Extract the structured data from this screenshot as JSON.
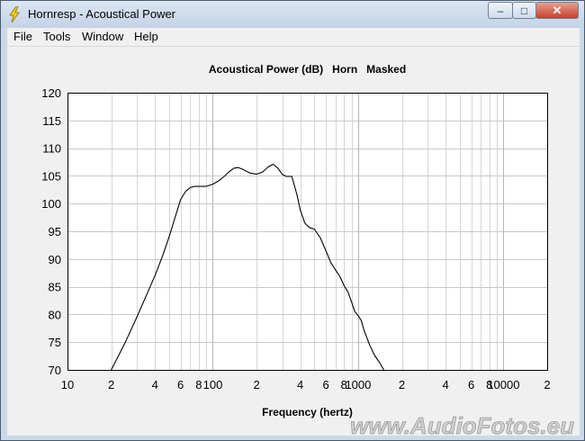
{
  "window": {
    "title": "Hornresp - Acoustical Power",
    "minimize_glyph": "–",
    "maximize_glyph": "□",
    "close_glyph": "✕",
    "app_icon": "lightning-bolt-icon"
  },
  "menu": {
    "items": [
      "File",
      "Tools",
      "Window",
      "Help"
    ]
  },
  "watermark": "www.AudioFotos.eu",
  "chart_data": {
    "type": "line",
    "title": "Acoustical Power (dB)   Horn   Masked",
    "xlabel": "Frequency (hertz)",
    "ylabel": "",
    "x_scale": "log",
    "xlim": [
      10,
      20000
    ],
    "ylim": [
      70,
      120
    ],
    "grid": true,
    "y_ticks": [
      70,
      75,
      80,
      85,
      90,
      95,
      100,
      105,
      110,
      115,
      120
    ],
    "x_ticks": [
      {
        "value": 10,
        "label": "10"
      },
      {
        "value": 20,
        "label": "2"
      },
      {
        "value": 40,
        "label": "4"
      },
      {
        "value": 60,
        "label": "6"
      },
      {
        "value": 80,
        "label": "8"
      },
      {
        "value": 100,
        "label": "100"
      },
      {
        "value": 200,
        "label": "2"
      },
      {
        "value": 400,
        "label": "4"
      },
      {
        "value": 600,
        "label": "6"
      },
      {
        "value": 800,
        "label": "8"
      },
      {
        "value": 1000,
        "label": "1000"
      },
      {
        "value": 2000,
        "label": "2"
      },
      {
        "value": 4000,
        "label": "4"
      },
      {
        "value": 6000,
        "label": "6"
      },
      {
        "value": 8000,
        "label": "8"
      },
      {
        "value": 10000,
        "label": "10000"
      },
      {
        "value": 20000,
        "label": "2"
      }
    ],
    "series": [
      {
        "color": "#000000",
        "x": [
          20,
          25,
          30,
          35,
          40,
          45,
          50,
          55,
          60,
          65,
          70,
          75,
          80,
          90,
          100,
          110,
          120,
          130,
          140,
          150,
          160,
          180,
          200,
          220,
          240,
          260,
          280,
          300,
          320,
          350,
          380,
          400,
          430,
          460,
          500,
          550,
          600,
          650,
          700,
          750,
          800,
          850,
          900,
          950,
          1000,
          1050,
          1100,
          1200,
          1300,
          1400,
          1500
        ],
        "y": [
          70,
          75,
          79.5,
          83.5,
          87,
          90.5,
          94,
          97.5,
          100.7,
          102.2,
          102.9,
          103.1,
          103.1,
          103.1,
          103.5,
          104.1,
          104.9,
          105.8,
          106.4,
          106.5,
          106.2,
          105.5,
          105.3,
          105.7,
          106.6,
          107.1,
          106.4,
          105.3,
          104.9,
          104.9,
          101.5,
          98.8,
          96.5,
          95.7,
          95.4,
          93.8,
          91.5,
          89.3,
          88,
          86.8,
          85.2,
          84.1,
          82.3,
          80.5,
          79.8,
          78.9,
          77.1,
          74.5,
          72.6,
          71.4,
          69.8
        ]
      }
    ]
  }
}
